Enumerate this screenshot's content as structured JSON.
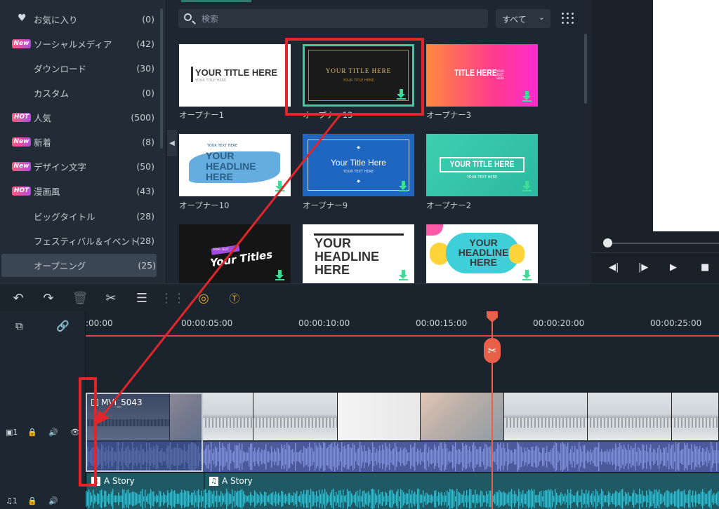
{
  "sidebar": {
    "categories": [
      {
        "label": "お気に入り",
        "count": "(0)",
        "badge": "",
        "icon": "heart-icon"
      },
      {
        "label": "ソーシャルメディア",
        "count": "(42)",
        "badge": "New"
      },
      {
        "label": "ダウンロード",
        "count": "(30)",
        "badge": ""
      },
      {
        "label": "カスタム",
        "count": "(0)",
        "badge": ""
      },
      {
        "label": "人気",
        "count": "(500)",
        "badge": "HOT"
      },
      {
        "label": "新着",
        "count": "(8)",
        "badge": "New"
      },
      {
        "label": "デザイン文字",
        "count": "(50)",
        "badge": "New"
      },
      {
        "label": "漫画風",
        "count": "(43)",
        "badge": "HOT"
      },
      {
        "label": "ビッグタイトル",
        "count": "(28)",
        "badge": ""
      },
      {
        "label": "フェスティバル＆イベント",
        "count": "(28)",
        "badge": ""
      },
      {
        "label": "オープニング",
        "count": "(25)",
        "badge": "",
        "active": true
      }
    ]
  },
  "library": {
    "search_placeholder": "検索",
    "filter_value": "すべて",
    "tiles": [
      {
        "label": "オープナー1",
        "text": "YOUR TITLE HERE",
        "sub": "YOUR TITLE HERE"
      },
      {
        "label": "オープナー13",
        "text": "YOUR TITLE HERE",
        "sub": "YOUR TITLE HERE"
      },
      {
        "label": "オープナー3",
        "text": "TITLE HERE",
        "sub": "YOUR TEXT HERE"
      },
      {
        "label": "オープナー10",
        "text": "YOUR HEADLINE HERE",
        "sub": "YOUR TEXT HERE"
      },
      {
        "label": "オープナー9",
        "text": "Your Title Here",
        "sub": "YOUR TEXT HERE"
      },
      {
        "label": "オープナー2",
        "text": "YOUR TITLE HERE",
        "sub": "YOUR TEXT HERE"
      },
      {
        "label": "",
        "text": "Your Titles",
        "sub": "YOUR TEXT"
      },
      {
        "label": "",
        "text": "YOUR HEADLINE HERE",
        "sub": ""
      },
      {
        "label": "",
        "text": "YOUR HEADLINE HERE",
        "sub": ""
      }
    ]
  },
  "toolbar": {
    "icons": [
      "undo-icon",
      "redo-icon",
      "delete-icon",
      "cut-icon",
      "adjust-icon",
      "audio-icon",
      "speed-icon",
      "text-icon"
    ]
  },
  "timeline": {
    "ruler": [
      ":00:00",
      "00:00:05:00",
      "00:00:10:00",
      "00:00:15:00",
      "00:00:20:00",
      "00:00:25:00"
    ],
    "video_clip_name": "MVI_5043",
    "audio_clips": [
      "A Story",
      "A Story"
    ],
    "video_track_index": "1",
    "audio_track_index": "1"
  },
  "colors": {
    "annotation": "#e0262b",
    "playhead": "#e8604a",
    "accent": "#3ddc97"
  }
}
